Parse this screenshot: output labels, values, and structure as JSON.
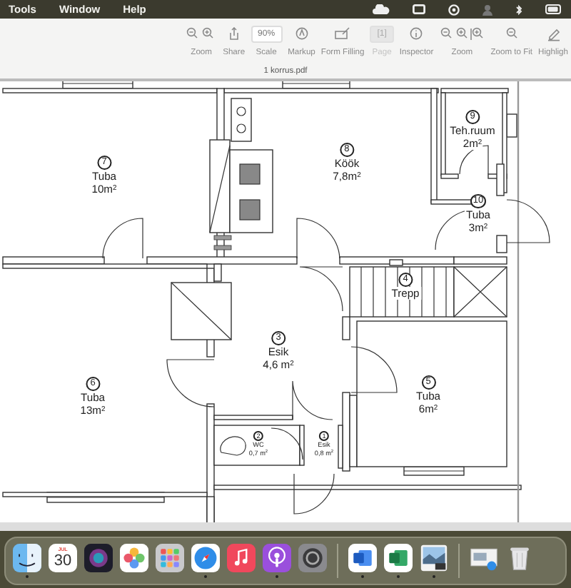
{
  "menu_bar": {
    "items": [
      "Tools",
      "Window",
      "Help"
    ]
  },
  "toolbar": {
    "items": [
      {
        "kind": "zoom2",
        "label": "Zoom",
        "disabled": false
      },
      {
        "kind": "share",
        "label": "Share",
        "disabled": false
      },
      {
        "kind": "scale",
        "label": "Scale",
        "value": "90%",
        "disabled": false
      },
      {
        "kind": "markup",
        "label": "Markup",
        "disabled": false
      },
      {
        "kind": "form",
        "label": "Form Filling",
        "disabled": false
      },
      {
        "kind": "page",
        "label": "Page",
        "value": "[1]",
        "disabled": true
      },
      {
        "kind": "inspector",
        "label": "Inspector",
        "disabled": false
      },
      {
        "kind": "zoom3",
        "label": "Zoom",
        "disabled": false
      },
      {
        "kind": "fit",
        "label": "Zoom to Fit",
        "disabled": false
      },
      {
        "kind": "highlight",
        "label": "Highligh",
        "disabled": false
      }
    ],
    "document_title": "1 korrus.pdf"
  },
  "rooms": [
    {
      "number": "7",
      "name": "Tuba",
      "area": "10m$^{2}$"
    },
    {
      "number": "8",
      "name": "Köök",
      "area": "7,8m$^{2}$"
    },
    {
      "number": "9",
      "name": "Teh.ruum",
      "area": "2m$^{2}$"
    },
    {
      "number": "10",
      "name": "Tuba",
      "area": "3m$^{2}$"
    },
    {
      "number": "4",
      "name": "Trepp"
    },
    {
      "number": "3",
      "name": "Esik",
      "area": "4,6 m$^{2}$"
    },
    {
      "number": "6",
      "name": "Tuba",
      "area": "13m$^{2}$"
    },
    {
      "number": "5",
      "name": "Tuba",
      "area": "6m$^{2}$"
    },
    {
      "number": "2",
      "name": "WC",
      "area": "0,7 m$^{2}$"
    },
    {
      "number": "1",
      "name": "Esik",
      "area": "0,8 m$^{2}$"
    }
  ],
  "dock": {
    "apps": [
      {
        "kind": "finder",
        "running": true
      },
      {
        "kind": "calendar",
        "month": "JUL",
        "day": "30",
        "running": false
      },
      {
        "kind": "siri",
        "running": false
      },
      {
        "kind": "photos",
        "running": false
      },
      {
        "kind": "launchpad",
        "running": false
      },
      {
        "kind": "safari",
        "running": true
      },
      {
        "kind": "music",
        "running": false
      },
      {
        "kind": "podcasts",
        "running": true
      },
      {
        "kind": "settings",
        "running": false
      },
      {
        "kind": "divider"
      },
      {
        "kind": "word",
        "running": true
      },
      {
        "kind": "excel",
        "running": true
      },
      {
        "kind": "preview",
        "running": true
      },
      {
        "kind": "divider"
      },
      {
        "kind": "downloads",
        "running": false
      },
      {
        "kind": "trash",
        "running": false
      }
    ]
  }
}
